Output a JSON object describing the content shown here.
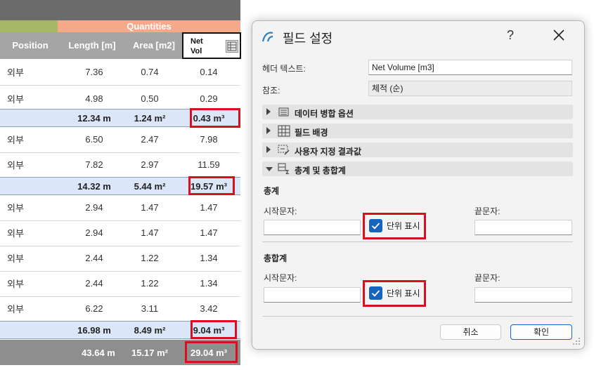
{
  "schedule": {
    "group_header": "Quantities",
    "columns": {
      "position": "Position",
      "length": "Length [m]",
      "area": "Area [m2]",
      "net_vol_line1": "Net",
      "net_vol_line2": "Vol"
    },
    "rows": [
      {
        "pos": "외부",
        "len": "7.36",
        "area": "0.74",
        "net": "0.14"
      },
      {
        "pos": "외부",
        "len": "4.98",
        "area": "0.50",
        "net": "0.29"
      },
      {
        "pos": "",
        "len": "12.34 m",
        "area": "1.24 m²",
        "net": "0.43 m³"
      },
      {
        "pos": "외부",
        "len": "6.50",
        "area": "2.47",
        "net": "7.98"
      },
      {
        "pos": "외부",
        "len": "7.82",
        "area": "2.97",
        "net": "11.59"
      },
      {
        "pos": "",
        "len": "14.32 m",
        "area": "5.44 m²",
        "net": "19.57 m³"
      },
      {
        "pos": "외부",
        "len": "2.94",
        "area": "1.47",
        "net": "1.47"
      },
      {
        "pos": "외부",
        "len": "2.94",
        "area": "1.47",
        "net": "1.47"
      },
      {
        "pos": "외부",
        "len": "2.44",
        "area": "1.22",
        "net": "1.34"
      },
      {
        "pos": "외부",
        "len": "2.44",
        "area": "1.22",
        "net": "1.34"
      },
      {
        "pos": "외부",
        "len": "6.22",
        "area": "3.11",
        "net": "3.42"
      },
      {
        "pos": "",
        "len": "16.98 m",
        "area": "8.49 m²",
        "net": "9.04 m³"
      }
    ],
    "total": {
      "len": "43.64 m",
      "area": "15.17 m²",
      "net": "29.04 m³"
    }
  },
  "dialog": {
    "title": "필드 설정",
    "help": "?",
    "header_text_label": "헤더 텍스트:",
    "header_text_value": "Net Volume [m3]",
    "reference_label": "참조:",
    "reference_value": "체적 (순)",
    "sections": {
      "merge_options": "데이터 병합 옵션",
      "field_background": "필드 배경",
      "custom_result": "사용자 지정 결과값",
      "totals": "총계 및 총합계"
    },
    "subtotal": {
      "heading": "총계",
      "prefix_label": "시작문자:",
      "show_units_label": "단위 표시",
      "suffix_label": "끝문자:"
    },
    "grand_total": {
      "heading": "총합계",
      "prefix_label": "시작문자:",
      "show_units_label": "단위 표시",
      "suffix_label": "끝문자:"
    },
    "cancel_label": "취소",
    "ok_label": "확인"
  },
  "colors": {
    "accent": "#1565c0",
    "highlight": "#d90f1f",
    "subtotal_bg": "#dbe7f9"
  }
}
